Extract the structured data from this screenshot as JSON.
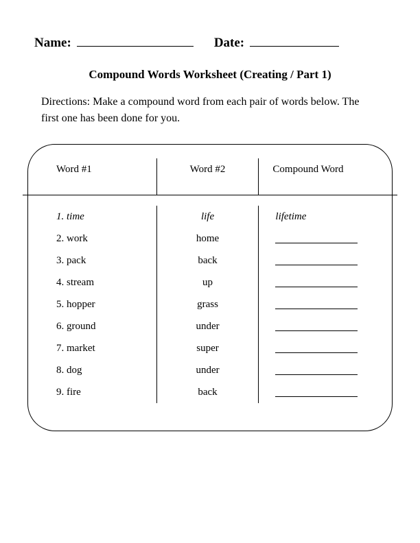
{
  "header": {
    "name_label": "Name:",
    "date_label": "Date:"
  },
  "title": "Compound Words Worksheet (Creating / Part 1)",
  "directions": "Directions: Make a compound word from each pair of words below. The first one has been done for you.",
  "columns": {
    "col1": "Word #1",
    "col2": "Word #2",
    "col3": "Compound Word"
  },
  "rows": [
    {
      "n": "1.",
      "w1": "time",
      "w2": "life",
      "ans": "lifetime",
      "example": true
    },
    {
      "n": "2.",
      "w1": "work",
      "w2": "home",
      "ans": "",
      "example": false
    },
    {
      "n": "3.",
      "w1": "pack",
      "w2": "back",
      "ans": "",
      "example": false
    },
    {
      "n": "4.",
      "w1": "stream",
      "w2": "up",
      "ans": "",
      "example": false
    },
    {
      "n": "5.",
      "w1": "hopper",
      "w2": "grass",
      "ans": "",
      "example": false
    },
    {
      "n": "6.",
      "w1": "ground",
      "w2": "under",
      "ans": "",
      "example": false
    },
    {
      "n": "7.",
      "w1": "market",
      "w2": "super",
      "ans": "",
      "example": false
    },
    {
      "n": "8.",
      "w1": "dog",
      "w2": "under",
      "ans": "",
      "example": false
    },
    {
      "n": "9.",
      "w1": "fire",
      "w2": "back",
      "ans": "",
      "example": false
    }
  ]
}
